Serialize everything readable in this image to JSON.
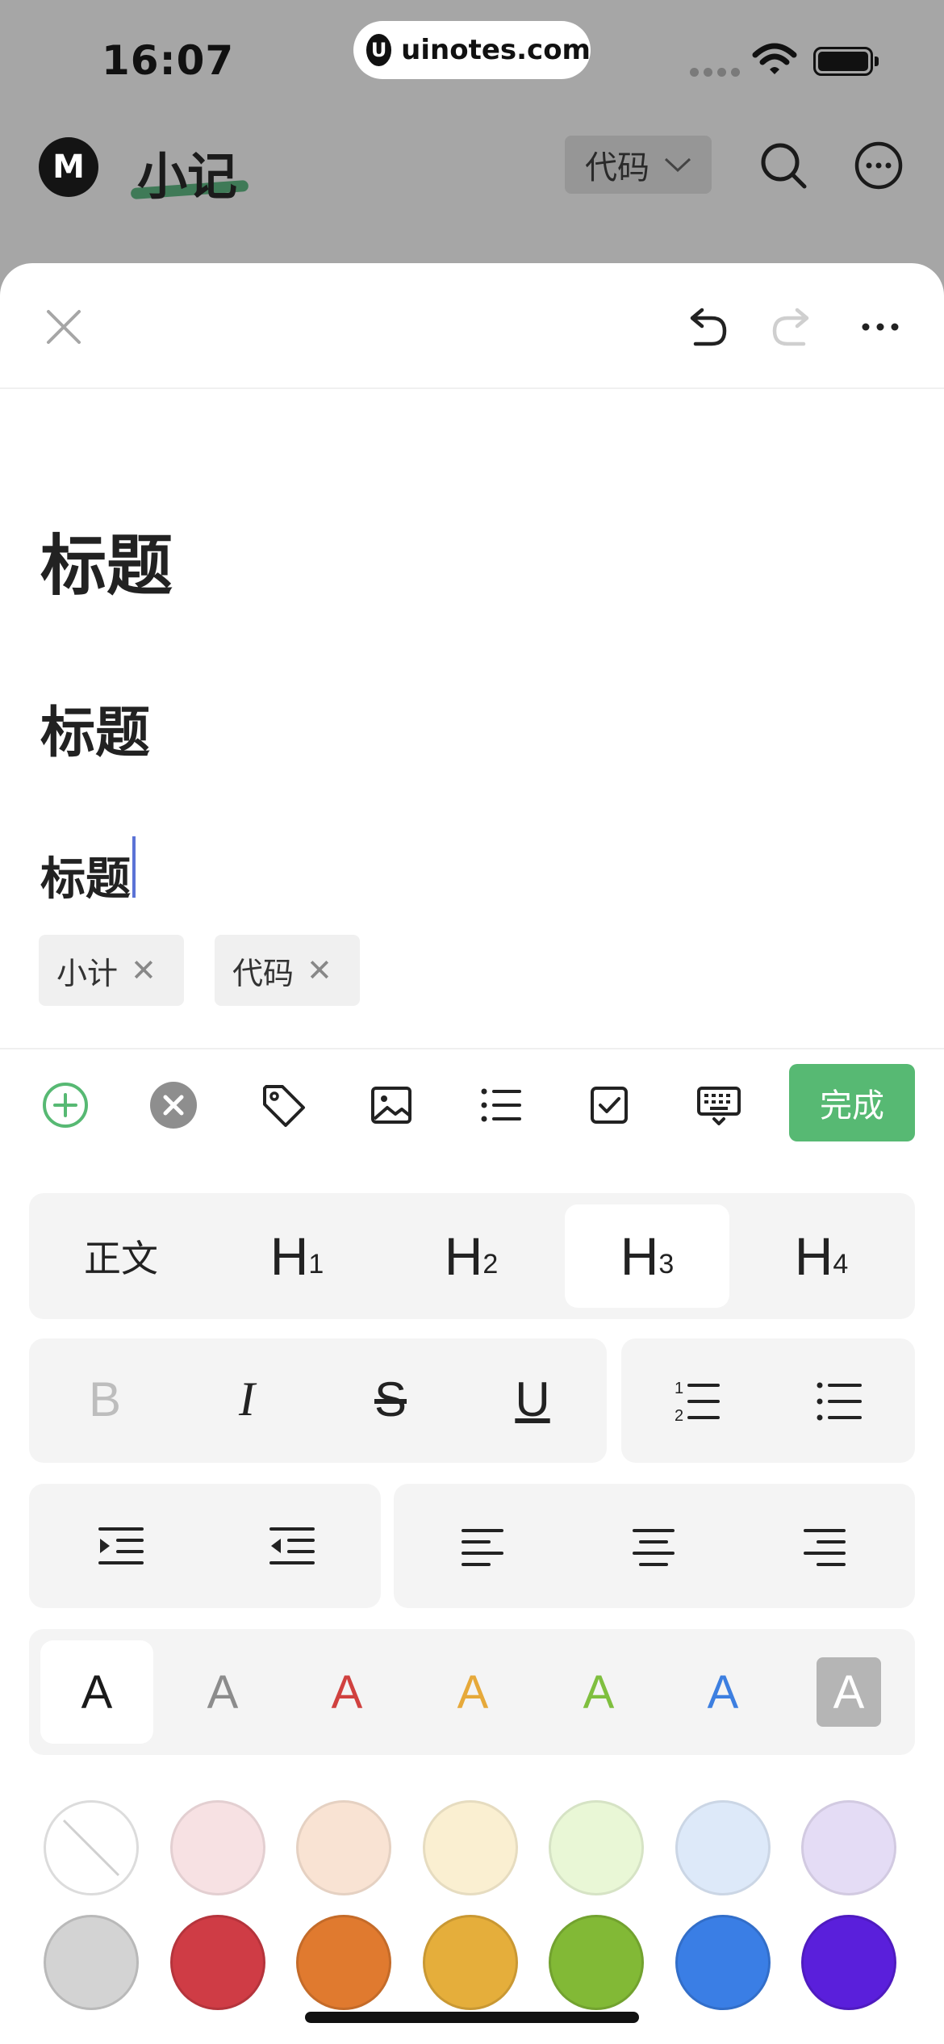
{
  "status_bar": {
    "time": "16:07",
    "url": "uinotes.com",
    "url_logo_letter": "U"
  },
  "app_header": {
    "logo_letter": "M",
    "title": "小记",
    "category": "代码",
    "icons": [
      "chevron-down-icon",
      "search-icon",
      "more-circle-icon"
    ]
  },
  "editor": {
    "toolbar_icons": [
      "close-icon",
      "undo-icon",
      "redo-icon",
      "more-horizontal-icon"
    ],
    "heading_1": "标题",
    "heading_2": "标题",
    "heading_3": "标题",
    "tags": [
      {
        "label": "小计"
      },
      {
        "label": "代码"
      }
    ]
  },
  "input_toolbar": {
    "icons": [
      "add-circle-icon",
      "clear-circle-icon",
      "tag-icon",
      "image-icon",
      "list-icon",
      "checkbox-icon",
      "keyboard-icon"
    ],
    "done_label": "完成"
  },
  "format_panel": {
    "headings": [
      {
        "label": "正文",
        "active": false
      },
      {
        "label": "H",
        "sub": "1",
        "active": false
      },
      {
        "label": "H",
        "sub": "2",
        "active": false
      },
      {
        "label": "H",
        "sub": "3",
        "active": true
      },
      {
        "label": "H",
        "sub": "4",
        "active": false
      }
    ],
    "text_styles": [
      {
        "label": "B",
        "name": "bold",
        "enabled": false
      },
      {
        "label": "I",
        "name": "italic",
        "enabled": true
      },
      {
        "label": "S",
        "name": "strikethrough",
        "enabled": true
      },
      {
        "label": "U",
        "name": "underline",
        "enabled": true
      }
    ],
    "list_icons": [
      "ordered-list-icon",
      "bullet-list-icon"
    ],
    "indent_icons": [
      "indent-icon",
      "outdent-icon"
    ],
    "align_icons": [
      "align-left-icon",
      "align-center-icon",
      "align-right-icon"
    ],
    "font_colors": [
      {
        "label": "A",
        "color": "#1a1a1a",
        "active": true
      },
      {
        "label": "A",
        "color": "#8c8c8c",
        "active": false
      },
      {
        "label": "A",
        "color": "#d0413f",
        "active": false
      },
      {
        "label": "A",
        "color": "#e6a93a",
        "active": false
      },
      {
        "label": "A",
        "color": "#7fbf3f",
        "active": false
      },
      {
        "label": "A",
        "color": "#3d7fe0",
        "active": false
      },
      {
        "label": "A",
        "color": "#ffffff",
        "active": false,
        "inverted": true
      }
    ],
    "background_colors_light": [
      "none",
      "#f7e1e3",
      "#f9e3d3",
      "#faefd1",
      "#e9f7d6",
      "#dde9f9",
      "#e4dcf5"
    ],
    "background_colors_bold": [
      "#d3d3d3",
      "#cf3c45",
      "#e07a2f",
      "#e5ae3b",
      "#82b936",
      "#3a7ee5",
      "#5a1fdb"
    ]
  }
}
